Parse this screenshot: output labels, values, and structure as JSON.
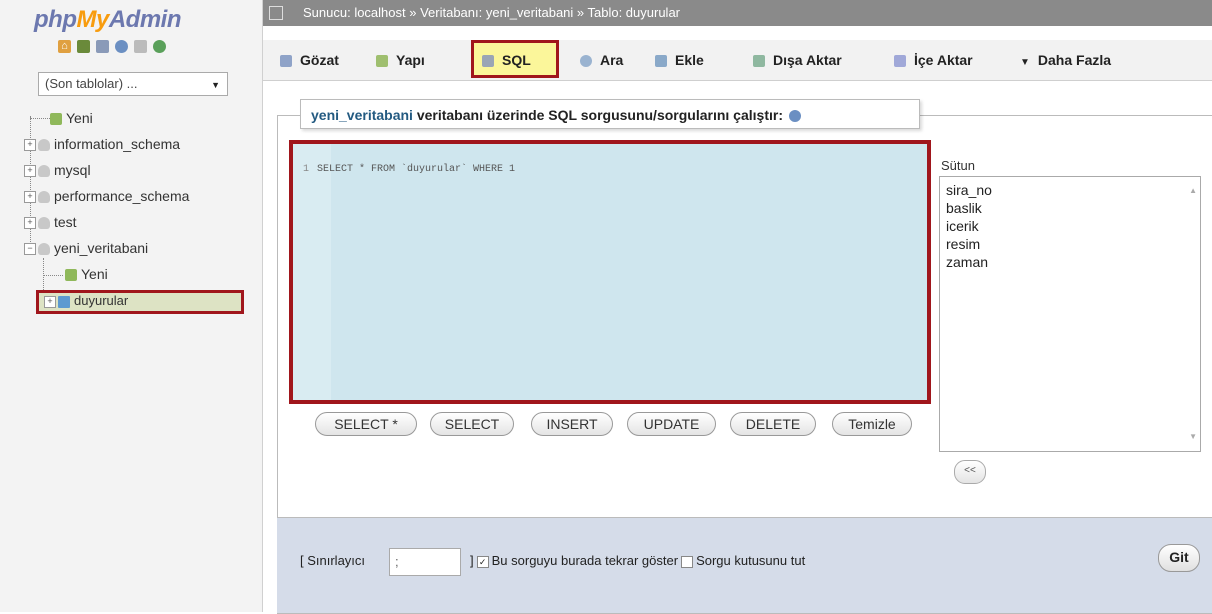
{
  "app": {
    "logo_part1": "php",
    "logo_part2": "My",
    "logo_part3": "Admin"
  },
  "nav": {
    "recent_tables": "(Son tablolar) ...",
    "tree": [
      {
        "label": "Yeni"
      },
      {
        "label": "information_schema"
      },
      {
        "label": "mysql"
      },
      {
        "label": "performance_schema"
      },
      {
        "label": "test"
      },
      {
        "label": "yeni_veritabani"
      },
      {
        "label": "Yeni"
      },
      {
        "label": "duyurular"
      }
    ]
  },
  "breadcrumb": "Sunucu: localhost » Veritabanı: yeni_veritabani » Tablo: duyurular",
  "tabs": [
    {
      "label": "Gözat"
    },
    {
      "label": "Yapı"
    },
    {
      "label": "SQL"
    },
    {
      "label": "Ara"
    },
    {
      "label": "Ekle"
    },
    {
      "label": "Dışa Aktar"
    },
    {
      "label": "İçe Aktar"
    },
    {
      "label": "Daha Fazla"
    }
  ],
  "query": {
    "legend_db": "yeni_veritabani",
    "legend_text": " veritabanı üzerinde SQL sorgusunu/sorgularını çalıştır:",
    "line_number": "1",
    "code": "SELECT * FROM `duyurular` WHERE 1",
    "buttons": [
      "SELECT *",
      "SELECT",
      "INSERT",
      "UPDATE",
      "DELETE",
      "Temizle"
    ],
    "columns_label": "Sütun",
    "columns": [
      "sira_no",
      "baslik",
      "icerik",
      "resim",
      "zaman"
    ],
    "insert_col_button": "<<"
  },
  "footer": {
    "delimiter_label": "[ Sınırlayıcı",
    "delimiter_value": ";",
    "show_again_label": "Bu sorguyu burada tekrar göster",
    "keep_box_label": "Sorgu kutusunu tut",
    "go_label": "Git"
  }
}
